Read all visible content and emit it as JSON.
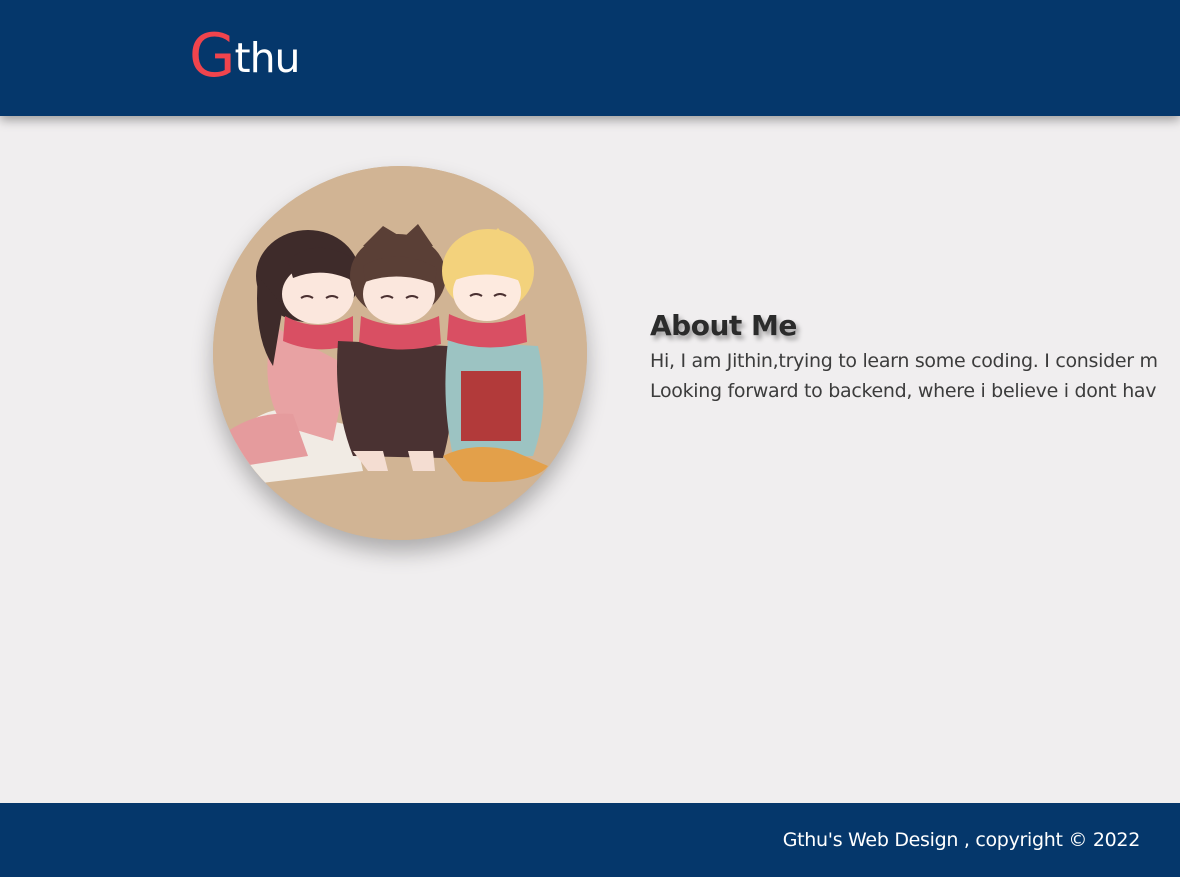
{
  "header": {
    "logo_initial": "G",
    "logo_rest": "thu",
    "background_color": "#05376b",
    "logo_accent_color": "#f0444d"
  },
  "profile": {
    "image_name": "anime-friends-avatar"
  },
  "about": {
    "title": "About Me",
    "lines": [
      "Hi, I am Jithin,trying to learn some coding. I consider m",
      "Looking forward to backend, where i believe i dont hav"
    ]
  },
  "footer": {
    "text": "Gthu's Web Design , copyright © 2022"
  }
}
